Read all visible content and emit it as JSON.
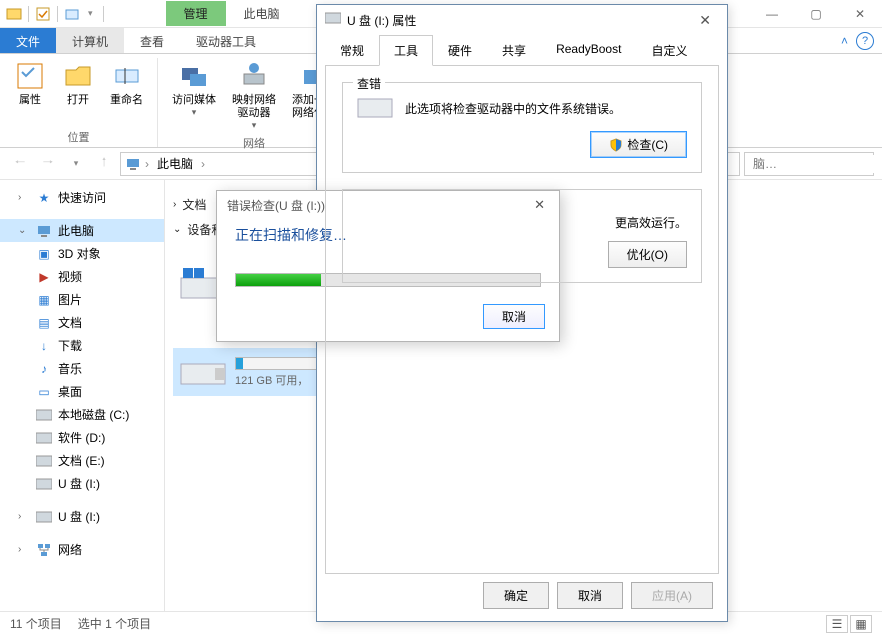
{
  "window": {
    "context_tab": "管理",
    "title_text": "此电脑",
    "controls": {
      "min": "—",
      "max": "▢",
      "close": "✕"
    }
  },
  "ribbon": {
    "tabs": {
      "file": "文件",
      "computer": "计算机",
      "view": "查看",
      "drivetools": "驱动器工具"
    },
    "location_group": {
      "props": "属性",
      "open": "打开",
      "rename": "重命名",
      "label": "位置"
    },
    "network_group": {
      "media": "访问媒体",
      "map": "映射网络\n驱动器",
      "add": "添加一个\n网络位置",
      "label": "网络"
    }
  },
  "address": {
    "breadcrumb_root": "此电脑",
    "search_placeholder": "脑…",
    "refresh": "↻"
  },
  "sidebar": {
    "quick": "快速访问",
    "thispc": "此电脑",
    "objects3d": "3D 对象",
    "videos": "视频",
    "pictures": "图片",
    "documents": "文档",
    "downloads": "下载",
    "music": "音乐",
    "desktop": "桌面",
    "localC": "本地磁盘 (C:)",
    "softD": "软件 (D:)",
    "docsE": "文档 (E:)",
    "usbI": "U 盘 (I:)",
    "usbI2": "U 盘 (I:)",
    "network": "网络"
  },
  "content": {
    "group_docs": "文档",
    "group_devices": "设备和",
    "drive_usb": {
      "subtext": "121 GB 可用，"
    }
  },
  "status": {
    "count": "11 个项目",
    "selected": "选中 1 个项目"
  },
  "props": {
    "title": "U 盘 (I:) 属性",
    "tabs": {
      "general": "常规",
      "tools": "工具",
      "hardware": "硬件",
      "sharing": "共享",
      "readyboost": "ReadyBoost",
      "custom": "自定义"
    },
    "chk": {
      "legend": "查错",
      "desc": "此选项将检查驱动器中的文件系统错误。",
      "btn": "检查(C)"
    },
    "opt": {
      "desc_tail": "更高效运行。",
      "btn": "优化(O)"
    },
    "actions": {
      "ok": "确定",
      "cancel": "取消",
      "apply": "应用(A)"
    }
  },
  "errchk": {
    "title": "错误检查(U 盘 (I:))",
    "heading": "正在扫描和修复…",
    "cancel": "取消"
  }
}
